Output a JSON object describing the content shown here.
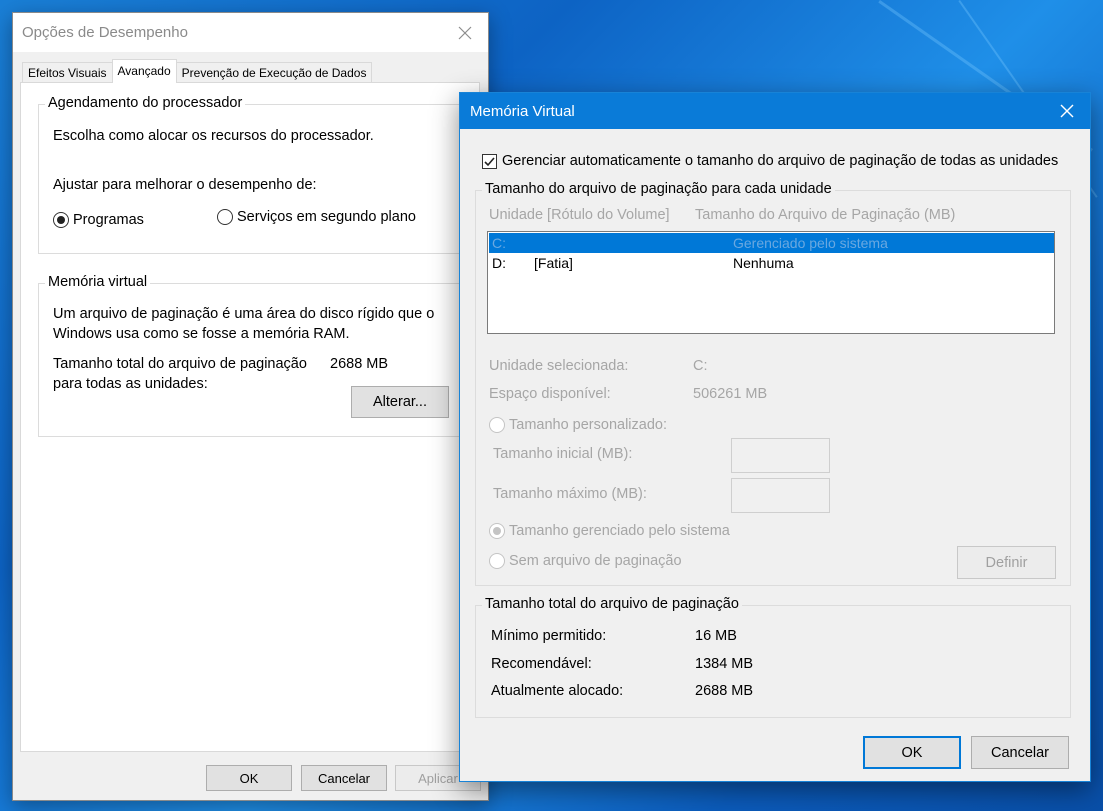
{
  "perf": {
    "title": "Opções de Desempenho",
    "tabs": [
      "Efeitos Visuais",
      "Avançado",
      "Prevenção de Execução de Dados"
    ],
    "scheduling": {
      "heading": "Agendamento do processador",
      "desc": "Escolha como alocar os recursos do processador.",
      "adjust": "Ajustar para melhorar o desempenho de:",
      "opt_programs": "Programas",
      "opt_services": "Serviços em segundo plano"
    },
    "vmem": {
      "heading": "Memória virtual",
      "desc1": "Um arquivo de paginação é uma área do disco rígido que o",
      "desc2": "Windows usa como se fosse a memória RAM.",
      "total_label": "Tamanho total do arquivo de paginação",
      "total_value": "2688 MB",
      "total_label2": "para todas as unidades:",
      "change_button": "Alterar..."
    },
    "buttons": {
      "ok": "OK",
      "cancel": "Cancelar",
      "apply": "Aplicar"
    }
  },
  "vm": {
    "title": "Memória Virtual",
    "auto_manage": "Gerenciar automaticamente o tamanho do arquivo de paginação de todas as unidades",
    "per_drive": {
      "heading": "Tamanho do arquivo de paginação para cada unidade",
      "col_drive": "Unidade [Rótulo do Volume]",
      "col_size": "Tamanho do Arquivo de Paginação (MB)",
      "rows": [
        {
          "drive": "C:",
          "label": "",
          "size": "Gerenciado pelo sistema"
        },
        {
          "drive": "D:",
          "label": "[Fatia]",
          "size": "Nenhuma"
        }
      ],
      "selected_drive_label": "Unidade selecionada:",
      "selected_drive_value": "C:",
      "space_label": "Espaço disponível:",
      "space_value": "506261 MB",
      "custom_size": "Tamanho personalizado:",
      "initial_size": "Tamanho inicial (MB):",
      "max_size": "Tamanho máximo (MB):",
      "system_managed": "Tamanho gerenciado pelo sistema",
      "no_paging": "Sem arquivo de paginação",
      "set_button": "Definir"
    },
    "totals": {
      "heading": "Tamanho total do arquivo de paginação",
      "min_label": "Mínimo permitido:",
      "min_value": "16 MB",
      "rec_label": "Recomendável:",
      "rec_value": "1384 MB",
      "cur_label": "Atualmente alocado:",
      "cur_value": "2688 MB"
    },
    "buttons": {
      "ok": "OK",
      "cancel": "Cancelar"
    }
  }
}
